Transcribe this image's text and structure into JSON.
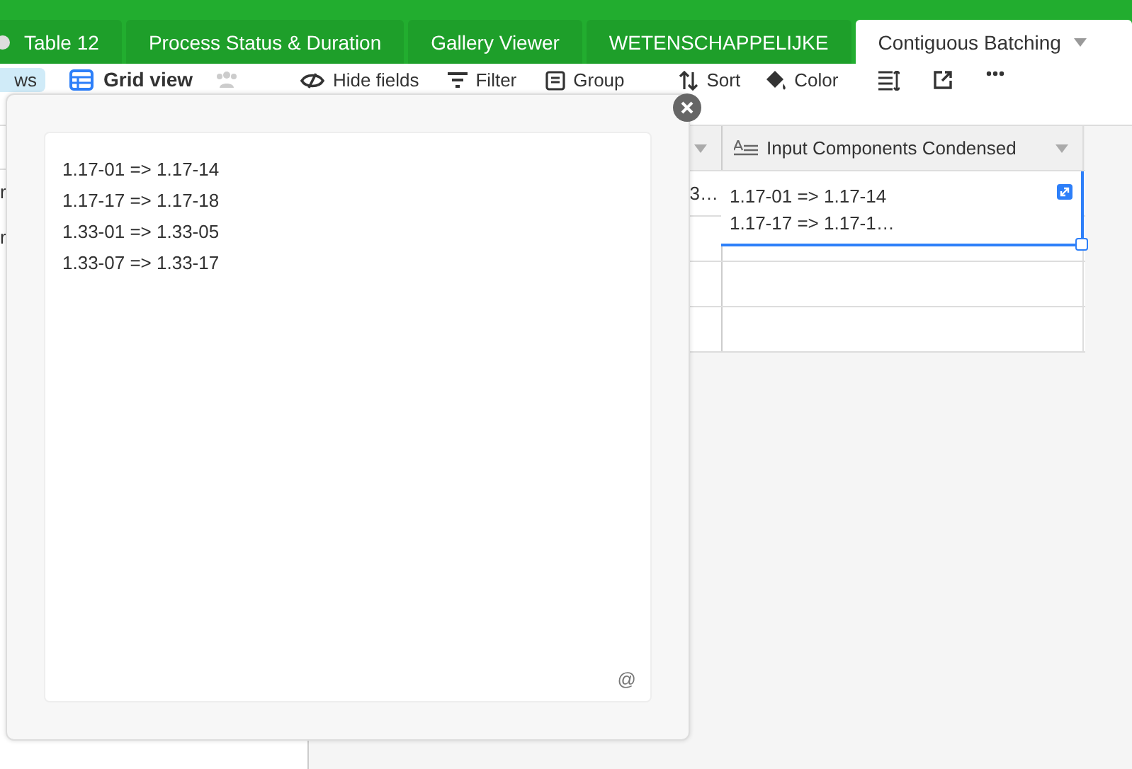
{
  "tabs": [
    {
      "label": "Table 12",
      "selected": false
    },
    {
      "label": "Process Status & Duration",
      "selected": false
    },
    {
      "label": "Gallery Viewer",
      "selected": false
    },
    {
      "label": "WETENSCHAPPELIJKE",
      "selected": false
    },
    {
      "label": "Contiguous Batching",
      "selected": true
    }
  ],
  "toolbar": {
    "views_label": "ws",
    "view_name": "Grid view",
    "buttons": [
      {
        "kind": "hide",
        "label": "Hide fields"
      },
      {
        "kind": "filter",
        "label": "Filter"
      },
      {
        "kind": "group",
        "label": "Group"
      },
      {
        "kind": "sort",
        "label": "Sort"
      },
      {
        "kind": "color",
        "label": "Color"
      },
      {
        "kind": "rowheight"
      },
      {
        "kind": "share"
      },
      {
        "kind": "more"
      }
    ]
  },
  "left_rows": [
    "r",
    "r"
  ],
  "table": {
    "column_2": {
      "header": "Input Components Condensed"
    },
    "rows": [
      {
        "column_1": "3…",
        "column_2_lines": [
          "1.17-01 => 1.17-14",
          "1.17-17 => 1.17-1…"
        ],
        "selected": true
      }
    ]
  },
  "expanded_editor": {
    "lines": [
      "1.17-01 => 1.17-14",
      "1.17-17 => 1.17-18",
      "1.33-01 => 1.33-05",
      "1.33-07 => 1.33-17"
    ],
    "mention_symbol": "@"
  }
}
